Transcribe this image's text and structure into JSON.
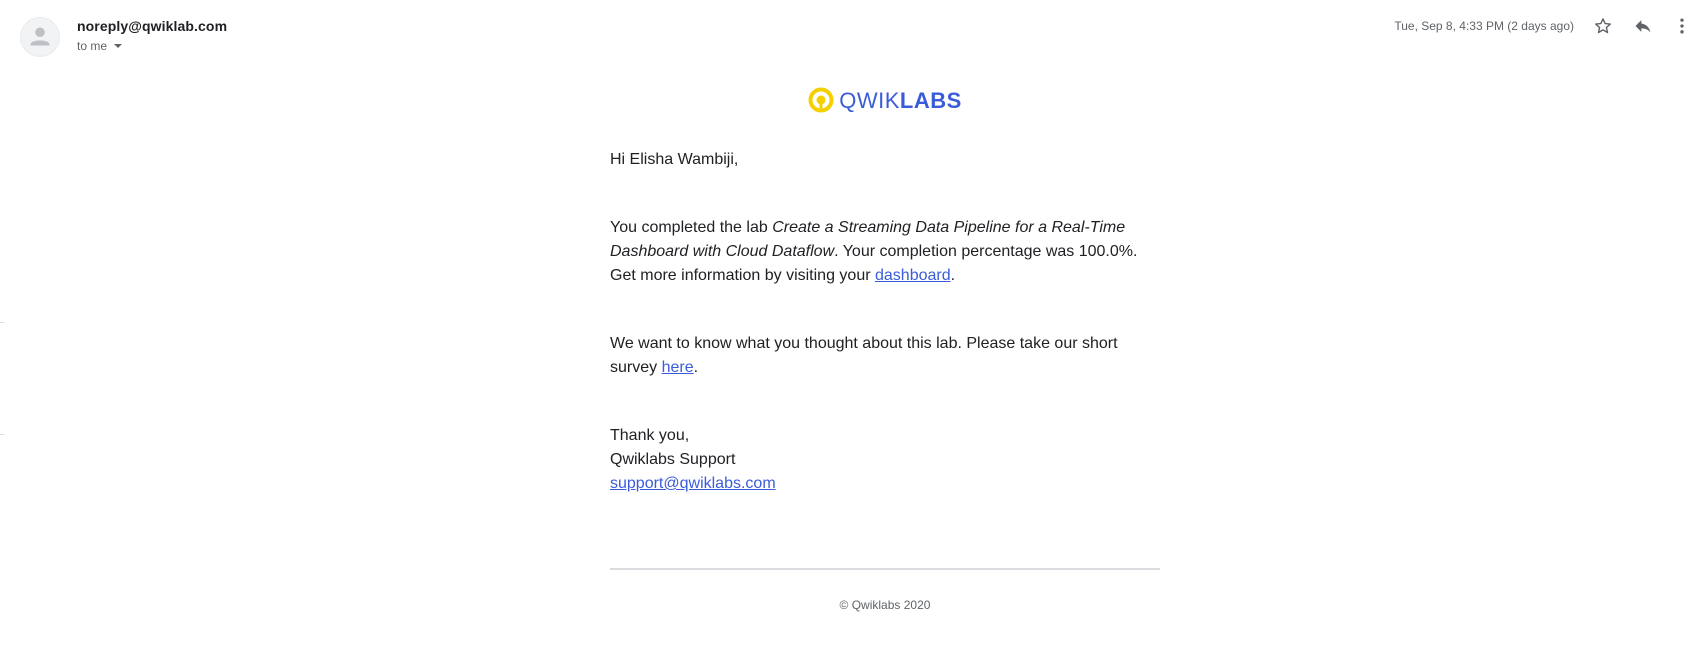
{
  "header": {
    "sender": "noreply@qwiklab.com",
    "recipient": "to me",
    "timestamp": "Tue, Sep 8, 4:33 PM (2 days ago)",
    "icons": [
      "person-avatar-icon",
      "star-icon",
      "reply-icon",
      "more-vert-icon"
    ]
  },
  "logo": {
    "thin": "QWIK",
    "bold": "LABS",
    "mark_color": "#f5d000",
    "text_color": "#3b5cd9"
  },
  "body": {
    "greeting": "Hi Elisha Wambiji,",
    "completion": {
      "prefix": "You completed the lab ",
      "lab_title": "Create a Streaming Data Pipeline for a Real-Time Dashboard with Cloud Dataflow",
      "middle": ". Your completion percentage was 100.0%. Get more information by visiting your ",
      "link": "dashboard",
      "suffix": "."
    },
    "survey": {
      "prefix": "We want to know what you thought about this lab. Please take our short survey ",
      "link": "here",
      "suffix": "."
    },
    "signoff": {
      "thanks": "Thank you,",
      "team": "Qwiklabs Support",
      "email": "support@qwiklabs.com"
    }
  },
  "footer": {
    "copyright": "© Qwiklabs 2020"
  },
  "colors": {
    "link": "#3b5cd9",
    "text": "#202124",
    "muted": "#5f6368"
  }
}
